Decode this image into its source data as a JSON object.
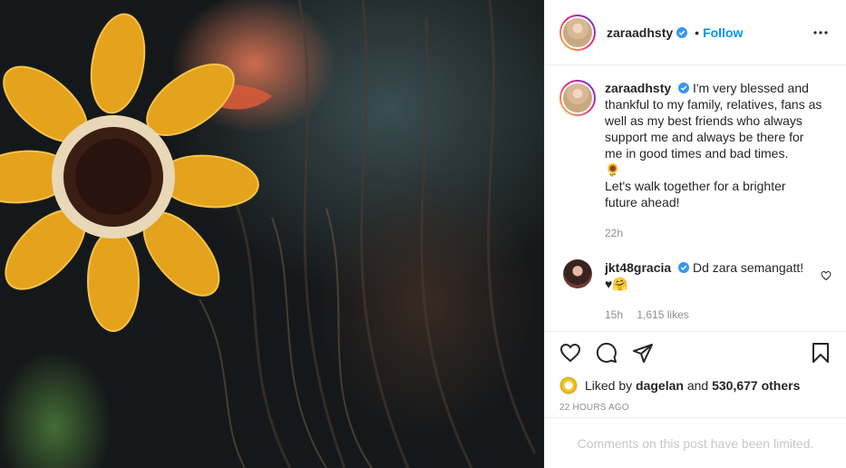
{
  "post": {
    "username": "zaraadhsty",
    "follow_label": "Follow",
    "separator": "•",
    "caption_lines": [
      "I'm very blessed and",
      "thankful to my family, relatives, fans as",
      "well as my best friends who always",
      "support me and always be there for",
      "me in good times and bad times.",
      "🌻",
      "Let's walk together for a brighter",
      "future ahead!"
    ],
    "caption_age": "22h"
  },
  "comment": {
    "username": "jkt48gracia",
    "text_line1": "Dd zara semangatt!",
    "text_line2": "♥🤗",
    "age": "15h",
    "likes": "1,615 likes"
  },
  "likes": {
    "prefix": "Liked by",
    "user": "dagelan",
    "mid": "and",
    "others": "530,677 others"
  },
  "timestamp": "22 HOURS AGO",
  "comments_limited": "Comments on this post have been limited.",
  "colors": {
    "accent": "#0095f6",
    "muted": "#8e8e8e",
    "text": "#262626",
    "verified": "#3897f0"
  },
  "icons": [
    "more-options-icon",
    "verified-badge-icon",
    "heart-icon",
    "comment-icon",
    "share-icon",
    "save-icon",
    "small-heart-icon"
  ]
}
